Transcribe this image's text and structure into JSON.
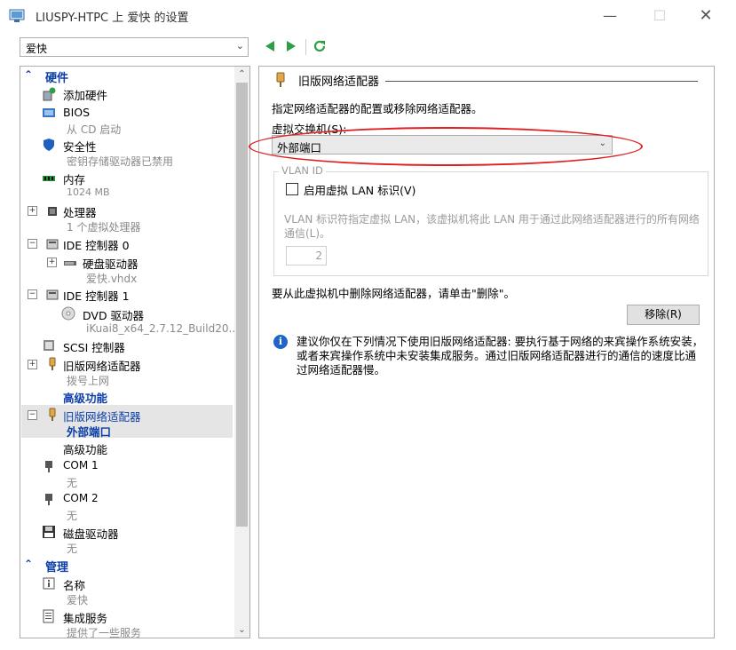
{
  "window": {
    "title": "LIUSPY-HTPC 上 爱快 的设置",
    "min_glyph": "—",
    "max_glyph": "☐",
    "close_glyph": "✕"
  },
  "vm_selector": {
    "value": "爱快",
    "arrow": "⌄"
  },
  "nav": {
    "back": "◀",
    "forward": "▶",
    "refresh": "↻"
  },
  "tree": {
    "scroll_up": "⌃",
    "scroll_down": "⌄",
    "hardware_section": {
      "chevron": "⌃",
      "label": "硬件"
    },
    "management_section": {
      "chevron": "⌃",
      "label": "管理"
    },
    "items": {
      "add_hardware": {
        "label": "添加硬件"
      },
      "bios": {
        "label": "BIOS",
        "sub": "从 CD 启动"
      },
      "security": {
        "label": "安全性",
        "sub": "密钥存储驱动器已禁用"
      },
      "memory": {
        "label": "内存",
        "sub": "1024 MB"
      },
      "processor": {
        "label": "处理器",
        "sub": "1 个虚拟处理器",
        "expander": "+"
      },
      "ide0": {
        "label": "IDE 控制器 0",
        "expander": "−"
      },
      "hdd": {
        "label": "硬盘驱动器",
        "sub": "爱快.vhdx",
        "expander": "+"
      },
      "ide1": {
        "label": "IDE 控制器 1",
        "expander": "−"
      },
      "dvd": {
        "label": "DVD 驱动器",
        "sub": "iKuai8_x64_2.7.12_Build20..."
      },
      "scsi": {
        "label": "SCSI 控制器"
      },
      "legacy_nic1": {
        "label": "旧版网络适配器",
        "sub": "拨号上网",
        "link": "高级功能",
        "expander": "+"
      },
      "legacy_nic2": {
        "label": "旧版网络适配器",
        "sub": "外部端口",
        "expander": "−"
      },
      "advanced": {
        "label": "高级功能"
      },
      "com1": {
        "label": "COM 1",
        "sub": "无"
      },
      "com2": {
        "label": "COM 2",
        "sub": "无"
      },
      "floppy": {
        "label": "磁盘驱动器",
        "sub": "无"
      },
      "name": {
        "label": "名称",
        "sub": "爱快"
      },
      "integration": {
        "label": "集成服务",
        "sub": "提供了一些服务"
      }
    }
  },
  "panel": {
    "group_title": "旧版网络适配器",
    "description": "指定网络适配器的配置或移除网络适配器。",
    "switch_label": "虚拟交换机(S):",
    "switch_value": "外部端口",
    "switch_arrow": "⌄",
    "vlan_title": "VLAN ID",
    "vlan_checkbox_label": "启用虚拟 LAN 标识(V)",
    "vlan_help": "VLAN 标识符指定虚拟 LAN，该虚拟机将此 LAN 用于通过此网络适配器进行的所有网络通信(L)。",
    "vlan_value": "2",
    "remove_text": "要从此虚拟机中删除网络适配器，请单击\"删除\"。",
    "remove_button": "移除(R)",
    "info_glyph": "i",
    "info_text": "建议你仅在下列情况下使用旧版网络适配器: 要执行基于网络的来宾操作系统安装，或者来宾操作系统中未安装集成服务。通过旧版网络适配器进行的通信的速度比通过网络适配器慢。"
  },
  "colors": {
    "link": "#0b3ea8",
    "annotation": "#e02020",
    "info": "#1f64c8"
  }
}
